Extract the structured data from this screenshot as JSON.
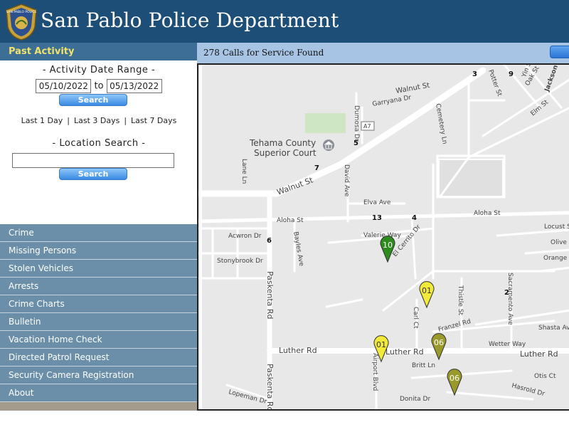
{
  "header": {
    "title": "San Pablo Police Department",
    "badge_text": "SAN PABLO POLICE"
  },
  "sidebar": {
    "heading": "Past Activity",
    "date_range": {
      "title": "- Activity Date Range -",
      "from": "05/10/2022",
      "to_label": "to",
      "to": "05/13/2022",
      "search_label": "Search"
    },
    "quick_links": [
      "Last 1 Day",
      "Last 3 Days",
      "Last 7 Days"
    ],
    "quick_sep": "|",
    "location": {
      "title": "- Location Search -",
      "value": "",
      "search_label": "Search"
    },
    "menu": [
      "Crime",
      "Missing Persons",
      "Stolen Vehicles",
      "Arrests",
      "Crime Charts",
      "Bulletin",
      "Vacation Home Check",
      "Directed Patrol Request",
      "Security Camera Registration",
      "About"
    ]
  },
  "results": {
    "text": "278 Calls for Service Found"
  },
  "map": {
    "streets": {
      "walnut": "Walnut St",
      "walnut_ne": "Walnut St",
      "garryana": "Garryana Dr",
      "dumosa": "Dumosa Dr",
      "cemetery": "Cemetery Ln",
      "david": "David Ave",
      "elva": "Elva Ave",
      "aloha_w": "Aloha St",
      "aloha_e": "Aloha St",
      "acwron": "Acwron Dr",
      "valerie": "Valerie Way",
      "elcerrito": "El Cerrito Dr",
      "bayles": "Bayles Ave",
      "stonybrook": "Stonybrook Dr",
      "paskenta_n": "Paskenta Rd",
      "paskenta_s": "Paskenta Rd",
      "luther_w": "Luther Rd",
      "luther_m": "Luther Rd",
      "luther_e": "Luther Rd",
      "airport": "Airport Blvd",
      "carl": "Carl Ct",
      "thistle": "Thistle St",
      "sacramento": "Sacramento Ave",
      "franzel": "Franzel Rd",
      "wetter": "Wetter Way",
      "britt": "Britt Ln",
      "shasta": "Shasta Av",
      "orange": "Orange S",
      "olive": "Olive S",
      "locust": "Locust St",
      "otis": "Otis Ct",
      "hasrold": "Hasrold Dr",
      "donita": "Donita Dr",
      "lopeman": "Lopeman Dr",
      "lane": "Lane Ln",
      "potter": "Potter St",
      "oak": "Oak St",
      "elm": "Elm St",
      "jackson": "Jackson St",
      "yin": "Yin St",
      "highway": "A7"
    },
    "poi": {
      "line1": "Tehama County",
      "line2": "Superior Court"
    },
    "counts": [
      "3",
      "9",
      "5",
      "7",
      "13",
      "4",
      "6",
      "2"
    ],
    "pins": [
      {
        "label": "10",
        "color": "#2e8b1e"
      },
      {
        "label": "01",
        "color": "#f2ea3a"
      },
      {
        "label": "01",
        "color": "#f2ea3a"
      },
      {
        "label": "06",
        "color": "#9a9a2c"
      },
      {
        "label": "06",
        "color": "#9a9a2c"
      }
    ]
  }
}
